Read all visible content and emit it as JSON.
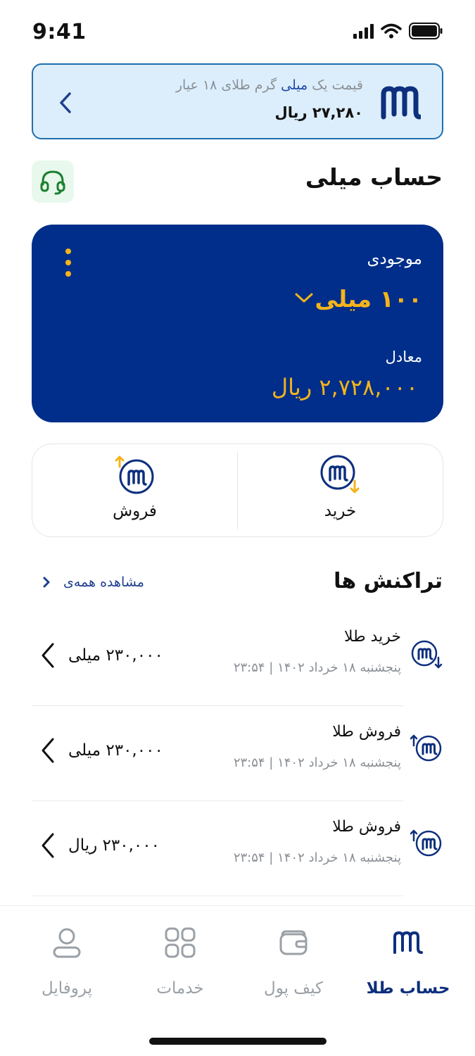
{
  "status_bar": {
    "time": "9:41"
  },
  "price_banner": {
    "line1_prefix": "قیمت یک",
    "line1_highlight": "میلی",
    "line1_suffix": "گرم طلای ۱۸ عیار",
    "price": "۲۷,۲۸۰ ریال"
  },
  "account": {
    "title": "حساب میلی"
  },
  "balance_card": {
    "balance_label": "موجودی",
    "balance_value": "۱۰۰ میلی",
    "equivalent_label": "معادل",
    "equivalent_value": "۲,۷۲۸,۰۰۰ ریال"
  },
  "actions": {
    "buy_label": "خرید",
    "sell_label": "فروش"
  },
  "transactions": {
    "title": "تراکنش ها",
    "view_all": "مشاهده همه‌ی",
    "items": [
      {
        "name": "خرید طلا",
        "date": "پنجشنبه ۱۸ خرداد ۱۴۰۲ | ۲۳:۵۴",
        "amount": "۲۳۰,۰۰۰ میلی",
        "kind": "buy"
      },
      {
        "name": "فروش طلا",
        "date": "پنجشنبه ۱۸ خرداد ۱۴۰۲ | ۲۳:۵۴",
        "amount": "۲۳۰,۰۰۰ میلی",
        "kind": "sell"
      },
      {
        "name": "فروش طلا",
        "date": "پنجشنبه ۱۸ خرداد ۱۴۰۲ | ۲۳:۵۴",
        "amount": "۲۳۰,۰۰۰ ریال",
        "kind": "sell"
      }
    ]
  },
  "bottom_nav": {
    "items": [
      {
        "label": "حساب طلا",
        "icon": "gold-account-icon",
        "active": true
      },
      {
        "label": "کیف پول",
        "icon": "wallet-icon",
        "active": false
      },
      {
        "label": "خدمات",
        "icon": "services-grid-icon",
        "active": false
      },
      {
        "label": "پروفایل",
        "icon": "profile-icon",
        "active": false
      }
    ]
  },
  "colors": {
    "primary": "#002e8a",
    "accent_gold": "#f4b41a",
    "banner_bg": "#dceefb",
    "banner_border": "#1f6fb0",
    "support_bg": "#e8f8ec",
    "support_icon": "#1a7f2e"
  }
}
